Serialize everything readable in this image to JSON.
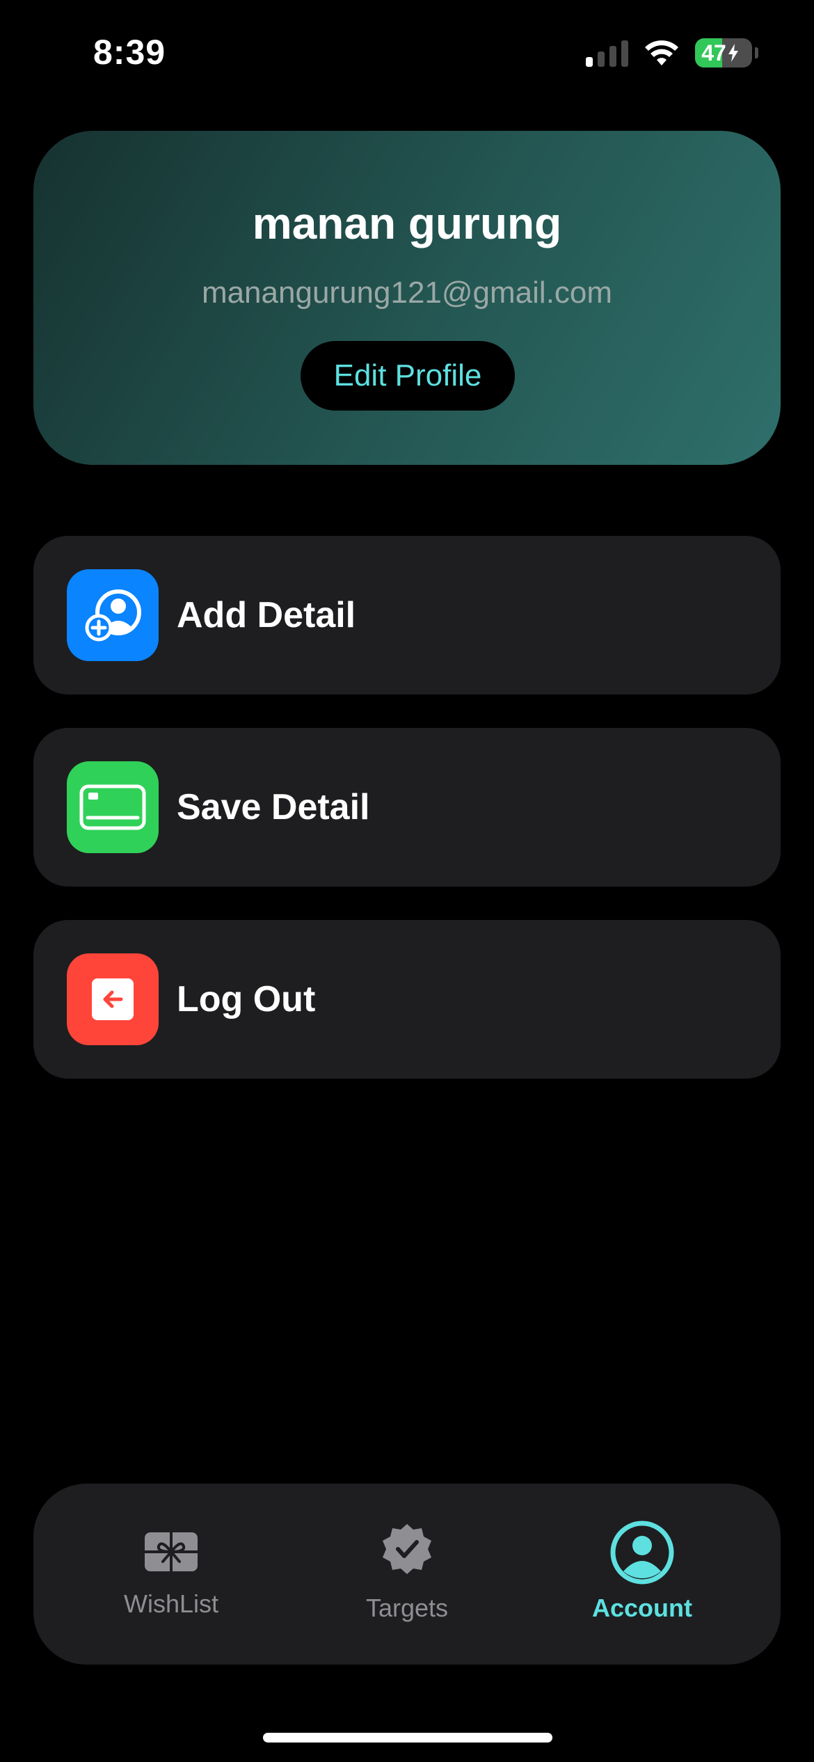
{
  "status_bar": {
    "time": "8:39",
    "battery_percent": "47",
    "battery_level": 0.47,
    "signal_bars_active": 1,
    "signal_bars_total": 4
  },
  "profile": {
    "name": "manan gurung",
    "email": "manangurung121@gmail.com",
    "edit_label": "Edit Profile"
  },
  "menu": {
    "items": [
      {
        "label": "Add Detail",
        "icon": "add-person-icon",
        "color": "#0a84ff"
      },
      {
        "label": "Save Detail",
        "icon": "card-icon",
        "color": "#30d158"
      },
      {
        "label": "Log Out",
        "icon": "logout-arrow-icon",
        "color": "#ff453a"
      }
    ]
  },
  "tabs": {
    "items": [
      {
        "label": "WishList",
        "icon": "gift-icon",
        "active": false
      },
      {
        "label": "Targets",
        "icon": "check-badge-icon",
        "active": false
      },
      {
        "label": "Account",
        "icon": "account-icon",
        "active": true
      }
    ],
    "active_color": "#5ee0e0",
    "inactive_color": "#8e8e93"
  }
}
